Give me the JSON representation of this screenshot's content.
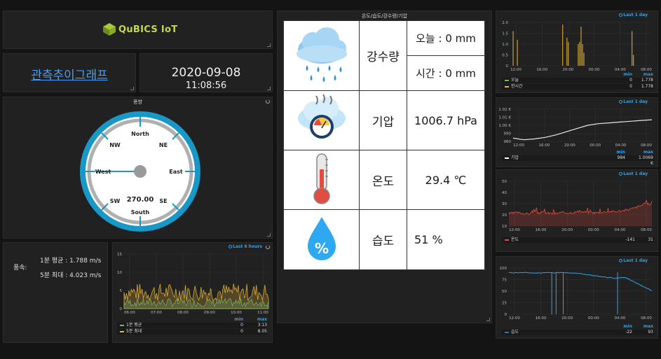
{
  "logo": {
    "text": "QuBICS IoT"
  },
  "graph_link": {
    "label": "관측추이그래프"
  },
  "datetime": {
    "date": "2020-09-08",
    "time": "11:08:56"
  },
  "compass": {
    "title": "풍향",
    "value": "270.00",
    "labels": {
      "north": "North",
      "south": "South",
      "east": "East",
      "west": "West",
      "ne": "NE",
      "nw": "NW",
      "se": "SE",
      "sw": "SW"
    }
  },
  "wind": {
    "label": "풍속:",
    "avg_1min": "1분 평균 : 1.788 m/s",
    "max_5min": "5분 최대 : 4.023 m/s"
  },
  "wind_chart": {
    "range_label": "Last 6 hours",
    "legend_min": "min",
    "legend_max": "max",
    "chart_data": {
      "type": "area",
      "x": [
        "06:00",
        "07:00",
        "08:00",
        "09:00",
        "10:00",
        "11:00"
      ],
      "yticks": [
        "0",
        "5",
        "10",
        "15"
      ],
      "ylim": [
        0,
        15
      ],
      "series": [
        {
          "name": "1분 평균",
          "color": "#7eb26d",
          "min": "0",
          "max": "3.13"
        },
        {
          "name": "5분 최대",
          "color": "#eab839",
          "min": "0",
          "max": "8.05"
        }
      ]
    }
  },
  "weather_table": {
    "title": "온도/습도/강수량/기압",
    "rain_label": "강수량",
    "rain_today": "오늘 : 0 mm",
    "rain_hour": "시간 : 0 mm",
    "pressure_label": "기압",
    "pressure_value": "1006.7 hPa",
    "temp_label": "온도",
    "temp_value": "29.4 ℃",
    "humidity_label": "습도",
    "humidity_value": "51 %",
    "icons": {
      "rain": "rain-cloud-icon",
      "pressure": "pressure-gauge-icon",
      "temp": "thermometer-icon",
      "humidity": "humidity-drop-icon"
    },
    "humidity_icon_text": "%"
  },
  "rain_chart": {
    "range_label": "Last 1 day",
    "legend_min": "min",
    "legend_max": "max",
    "chart_data": {
      "type": "bar",
      "x": [
        "12:00",
        "16:00",
        "20:00",
        "00:00",
        "04:00",
        "08:00"
      ],
      "yticks": [
        "0",
        "0.5",
        "1.0",
        "1.5",
        "2.0"
      ],
      "ylim": [
        0,
        2.0
      ],
      "series": [
        {
          "name": "오늘",
          "color": "#7eb26d",
          "min": "0",
          "max": "1.778"
        },
        {
          "name": "한시간",
          "color": "#eab839",
          "min": "0",
          "max": "1.778"
        }
      ]
    }
  },
  "pressure_chart": {
    "range_label": "Last 1 day",
    "legend_min": "min",
    "legend_max": "max",
    "chart_data": {
      "type": "line",
      "x": [
        "12:00",
        "16:00",
        "20:00",
        "00:00",
        "04:00",
        "08:00"
      ],
      "yticks": [
        "980",
        "990",
        "1.00 K",
        "1.01 K",
        "1.02 K"
      ],
      "ylim": [
        980,
        1020
      ],
      "series": [
        {
          "name": "기압",
          "color": "#ffffff",
          "min": "984",
          "max": "1.0069 K",
          "values": [
            984,
            982,
            983,
            985,
            988,
            992,
            996,
            1000,
            1002,
            1003,
            1004,
            1005,
            1006,
            1006.9
          ]
        }
      ]
    }
  },
  "temp_chart": {
    "range_label": "Last 1 day",
    "legend_min": "min",
    "legend_max": "max",
    "chart_data": {
      "type": "line",
      "x": [
        "12:00",
        "16:00",
        "20:00",
        "00:00",
        "04:00",
        "08:00"
      ],
      "yticks": [
        "10",
        "20",
        "30",
        "40",
        "50"
      ],
      "ylim": [
        10,
        50
      ],
      "series": [
        {
          "name": "온도",
          "color": "#e24d42",
          "min": "-141",
          "max": "31",
          "values": [
            21,
            22,
            21,
            22,
            22,
            21,
            22,
            22,
            23,
            22,
            22,
            23,
            23,
            24,
            26,
            29,
            30
          ]
        }
      ]
    }
  },
  "humidity_chart": {
    "range_label": "Last 1 day",
    "legend_min": "min",
    "legend_max": "max",
    "chart_data": {
      "type": "line",
      "x": [
        "12:00",
        "16:00",
        "20:00",
        "00:00",
        "04:00",
        "08:00"
      ],
      "yticks": [
        "0",
        "25",
        "50",
        "75",
        "100"
      ],
      "ylim": [
        0,
        100
      ],
      "series": [
        {
          "name": "습도",
          "color": "#1f78c1",
          "min": "-22",
          "max": "93",
          "values": [
            90,
            90,
            90,
            89,
            90,
            90,
            90,
            89,
            88,
            85,
            82,
            80,
            78,
            80,
            70,
            60,
            51
          ]
        }
      ]
    }
  }
}
